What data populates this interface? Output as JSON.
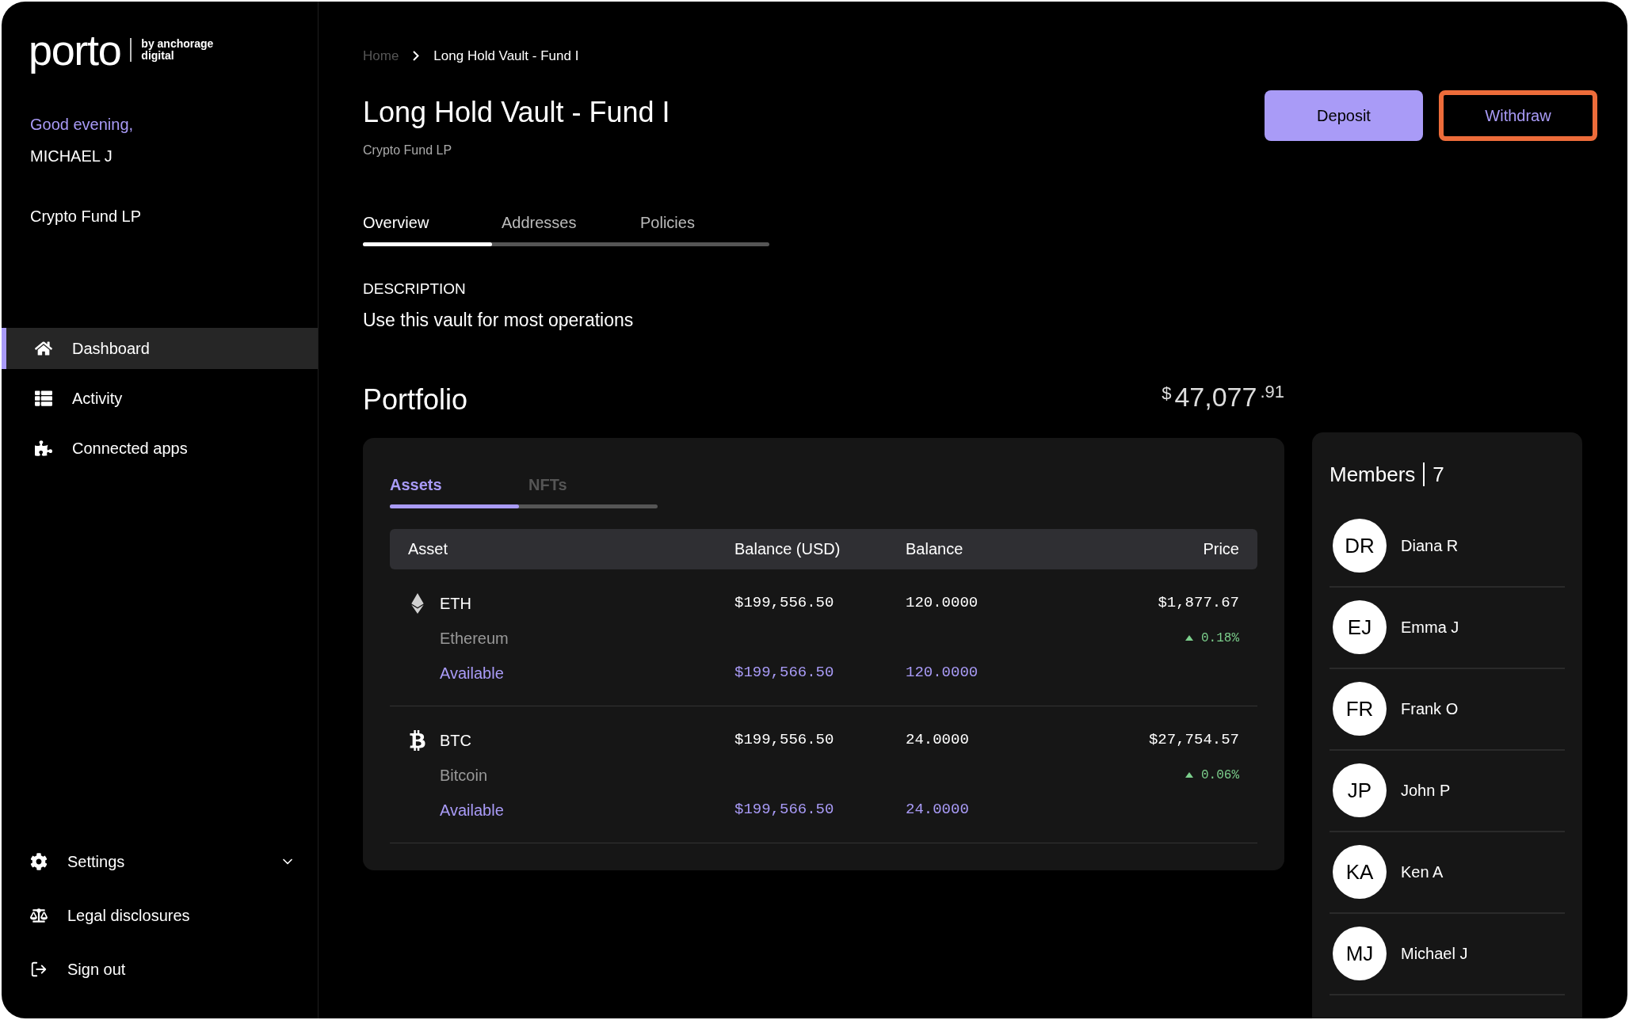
{
  "logo": {
    "wordmark": "porto",
    "tagline": [
      "by anchorage",
      "digital"
    ]
  },
  "sidebar": {
    "greeting": "Good evening,",
    "user": "MICHAEL J",
    "organization": "Crypto Fund LP",
    "nav": [
      {
        "label": "Dashboard",
        "kind": "home",
        "selected": true
      },
      {
        "label": "Activity",
        "kind": "list",
        "selected": false
      },
      {
        "label": "Connected apps",
        "kind": "puzzle",
        "selected": false
      }
    ],
    "footer": [
      {
        "label": "Settings",
        "kind": "settings",
        "expanded": false
      },
      {
        "label": "Legal disclosures",
        "kind": "scale"
      },
      {
        "label": "Sign out",
        "kind": "signout"
      }
    ]
  },
  "breadcrumb": [
    "Home",
    "Long Hold Vault - Fund I"
  ],
  "title": "Long Hold Vault - Fund I",
  "subtitle": "Crypto Fund LP",
  "actions": [
    {
      "label": "Deposit",
      "kind": "primary",
      "focused": false
    },
    {
      "label": "Withdraw",
      "kind": "outline",
      "focused": true
    }
  ],
  "tabs": [
    {
      "label": "Overview",
      "selected": true
    },
    {
      "label": "Addresses",
      "selected": false
    },
    {
      "label": "Policies",
      "selected": false
    }
  ],
  "description": {
    "label": "DESCRIPTION",
    "text": "Use this vault for most operations"
  },
  "portfolio": {
    "title": "Portfolio",
    "total": {
      "currency": "$",
      "whole": "47,077",
      "cents": ".91"
    },
    "tabs": [
      {
        "label": "Assets",
        "selected": true
      },
      {
        "label": "NFTs",
        "selected": false
      }
    ],
    "table": {
      "columns": [
        "Asset",
        "Balance (USD)",
        "Balance",
        "Price"
      ],
      "rows": [
        {
          "kind": "eth",
          "symbol": "ETH",
          "name": "Ethereum",
          "balance_usd": "$199,556.50",
          "balance": "120.0000",
          "price": "$1,877.67",
          "change": {
            "kind": "up",
            "text": "0.18%"
          },
          "available_label": "Available",
          "available_usd": "$199,566.50",
          "available_balance": "120.0000"
        },
        {
          "kind": "btc",
          "symbol": "BTC",
          "name": "Bitcoin",
          "balance_usd": "$199,556.50",
          "balance": "24.0000",
          "price": "$27,754.57",
          "change": {
            "kind": "up",
            "text": "0.06%"
          },
          "available_label": "Available",
          "available_usd": "$199,566.50",
          "available_balance": "24.0000"
        }
      ]
    }
  },
  "members": {
    "title": "Members",
    "count": "7",
    "items": [
      {
        "initials": "DR",
        "name": "Diana R"
      },
      {
        "initials": "EJ",
        "name": "Emma J"
      },
      {
        "initials": "FR",
        "name": "Frank O"
      },
      {
        "initials": "JP",
        "name": "John P"
      },
      {
        "initials": "KA",
        "name": "Ken A"
      },
      {
        "initials": "MJ",
        "name": "Michael J"
      }
    ]
  }
}
